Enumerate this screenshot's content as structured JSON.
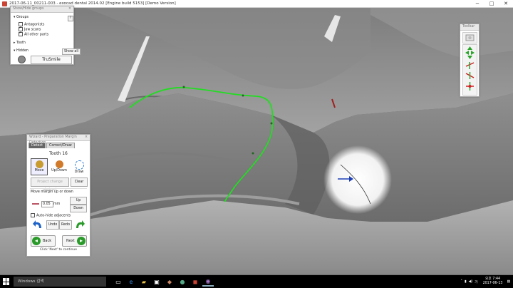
{
  "window": {
    "title": "2017-06-11_00211-003 - exocad dental 2014.02 [Engine build 5153] [Demo Version]",
    "minimize": "−",
    "maximize": "□",
    "close": "✕"
  },
  "show_hide_panel": {
    "title": "Show/Hide groups",
    "groups_label": "Groups",
    "help": "?",
    "items": [
      "Antagonists",
      "Jaw scans",
      "All other parts"
    ],
    "tooth_label": "Tooth",
    "hidden_label": "Hidden",
    "show_all": "Show all",
    "trusmile": "TruSmile"
  },
  "toolbar_panel": {
    "title": "Toolbar"
  },
  "wizard": {
    "title": "Wizard - Preparation Margin Detection",
    "tabs": [
      "Detect",
      "Correct/Draw"
    ],
    "tooth": "Tooth 16",
    "tools": [
      "Move",
      "Up/Down",
      "Draw"
    ],
    "prev_btn": "Project change obstruct",
    "clear": "Clear",
    "move_margin_label": "Move margin up or down",
    "value": "0.05",
    "unit": "mm",
    "up": "Up",
    "down": "Down",
    "auto_hide": "Auto-hide adjacents",
    "undo": "Undo",
    "redo": "Redo",
    "back": "Back",
    "next": "Next",
    "hint": "Click 'Next' to continue"
  },
  "taskbar": {
    "search_placeholder": "Windows 검색",
    "tray_lang": "오후 7:44",
    "date": "2017-06-13",
    "ime": "가"
  },
  "colors": {
    "margin_line": "#22dd22",
    "model": "#9a9a9a",
    "next_button": "#2a9b2a"
  }
}
